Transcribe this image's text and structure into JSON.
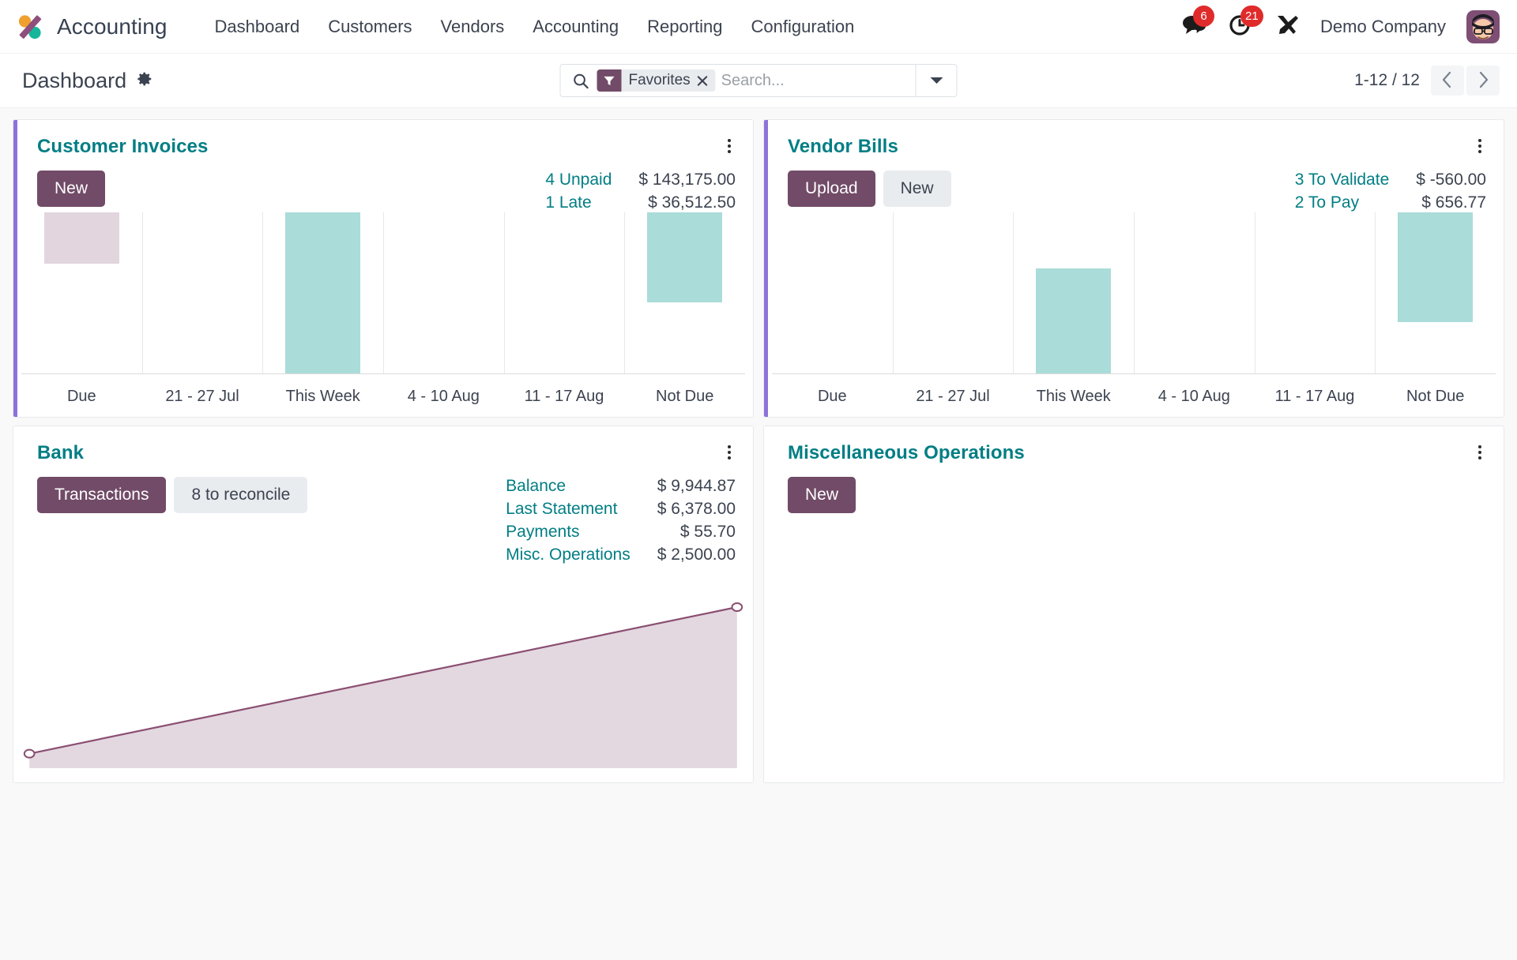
{
  "navbar": {
    "brand": "Accounting",
    "logo_icon": "odoo-logo-icon",
    "menu": [
      {
        "label": "Dashboard"
      },
      {
        "label": "Customers"
      },
      {
        "label": "Vendors"
      },
      {
        "label": "Accounting"
      },
      {
        "label": "Reporting"
      },
      {
        "label": "Configuration"
      }
    ],
    "messages_icon": "chat-bubble-icon",
    "messages_count": "6",
    "activities_icon": "clock-icon",
    "activities_count": "21",
    "debug_icon": "tools-wrench-icon",
    "company": "Demo Company",
    "avatar_icon": "user-avatar-icon"
  },
  "control_panel": {
    "breadcrumb": "Dashboard",
    "settings_icon": "gear-icon",
    "search": {
      "search_icon": "search-icon",
      "facet_icon": "filter-funnel-icon",
      "facet_label": "Favorites",
      "facet_remove_icon": "close-x-icon",
      "placeholder": "Search...",
      "value": "",
      "toggle_icon": "chevron-down-icon"
    },
    "pager": {
      "value": "1-12 / 12",
      "prev_icon": "chevron-left-icon",
      "next_icon": "chevron-right-icon"
    }
  },
  "cards": {
    "customer_invoices": {
      "title": "Customer Invoices",
      "kebab_icon": "vertical-dots-icon",
      "buttons": [
        {
          "label": "New",
          "style": "primary"
        }
      ],
      "figures": [
        {
          "label": "4 Unpaid",
          "value": "$ 143,175.00"
        },
        {
          "label": "1 Late",
          "value": "$ 36,512.50"
        }
      ]
    },
    "vendor_bills": {
      "title": "Vendor Bills",
      "kebab_icon": "vertical-dots-icon",
      "buttons": [
        {
          "label": "Upload",
          "style": "primary"
        },
        {
          "label": "New",
          "style": "secondary"
        }
      ],
      "figures": [
        {
          "label": "3 To Validate",
          "value": "$ -560.00"
        },
        {
          "label": "2 To Pay",
          "value": "$ 656.77"
        }
      ]
    },
    "bank": {
      "title": "Bank",
      "kebab_icon": "vertical-dots-icon",
      "buttons": [
        {
          "label": "Transactions",
          "style": "primary"
        },
        {
          "label": "8 to reconcile",
          "style": "secondary"
        }
      ],
      "figures": [
        {
          "label": "Balance",
          "value": "$ 9,944.87"
        },
        {
          "label": "Last Statement",
          "value": "$ 6,378.00"
        },
        {
          "label": "Payments",
          "value": "$ 55.70"
        },
        {
          "label": "Misc. Operations",
          "value": "$ 2,500.00"
        }
      ]
    },
    "misc_operations": {
      "title": "Miscellaneous Operations",
      "kebab_icon": "vertical-dots-icon",
      "buttons": [
        {
          "label": "New",
          "style": "primary"
        }
      ],
      "figures": []
    }
  },
  "colors": {
    "brand_purple": "#714b67",
    "accent_bar": "#8d73d8",
    "title_teal": "#017e84",
    "bar_teal": "#aadcd9",
    "bar_mauve": "#e2d5de",
    "badge_red": "#e02b2b",
    "line_purple": "#8a4f72",
    "area_fill": "#e4d8e0"
  },
  "chart_data": [
    {
      "id": "customer_invoices_chart",
      "type": "bar",
      "title": "Customer Invoices",
      "categories": [
        "Due",
        "21 - 27 Jul",
        "This Week",
        "4 - 10 Aug",
        "11 - 17 Aug",
        "Not Due"
      ],
      "values": [
        32,
        0,
        100,
        0,
        0,
        56
      ],
      "bar_colors": [
        "#e2d5de",
        null,
        "#aadcd9",
        null,
        null,
        "#aadcd9"
      ],
      "bar_offsets": [
        68,
        0,
        0,
        0,
        0,
        44
      ],
      "xlabel": "",
      "ylabel": "",
      "grid": true,
      "legend": "none"
    },
    {
      "id": "vendor_bills_chart",
      "type": "bar",
      "title": "Vendor Bills",
      "categories": [
        "Due",
        "21 - 27 Jul",
        "This Week",
        "4 - 10 Aug",
        "11 - 17 Aug",
        "Not Due"
      ],
      "values": [
        0,
        0,
        65,
        0,
        0,
        68
      ],
      "bar_colors": [
        null,
        null,
        "#aadcd9",
        null,
        null,
        "#aadcd9"
      ],
      "bar_offsets": [
        0,
        0,
        0,
        0,
        0,
        32
      ],
      "xlabel": "",
      "ylabel": "",
      "grid": true,
      "legend": "none"
    },
    {
      "id": "bank_balance_chart",
      "type": "area",
      "title": "Bank",
      "x": [
        0,
        1
      ],
      "values": [
        9,
        100
      ],
      "line_color": "#8a4f72",
      "fill_color": "#e4d8e0",
      "xlabel": "",
      "ylabel": "",
      "grid": false,
      "legend": "none"
    }
  ]
}
